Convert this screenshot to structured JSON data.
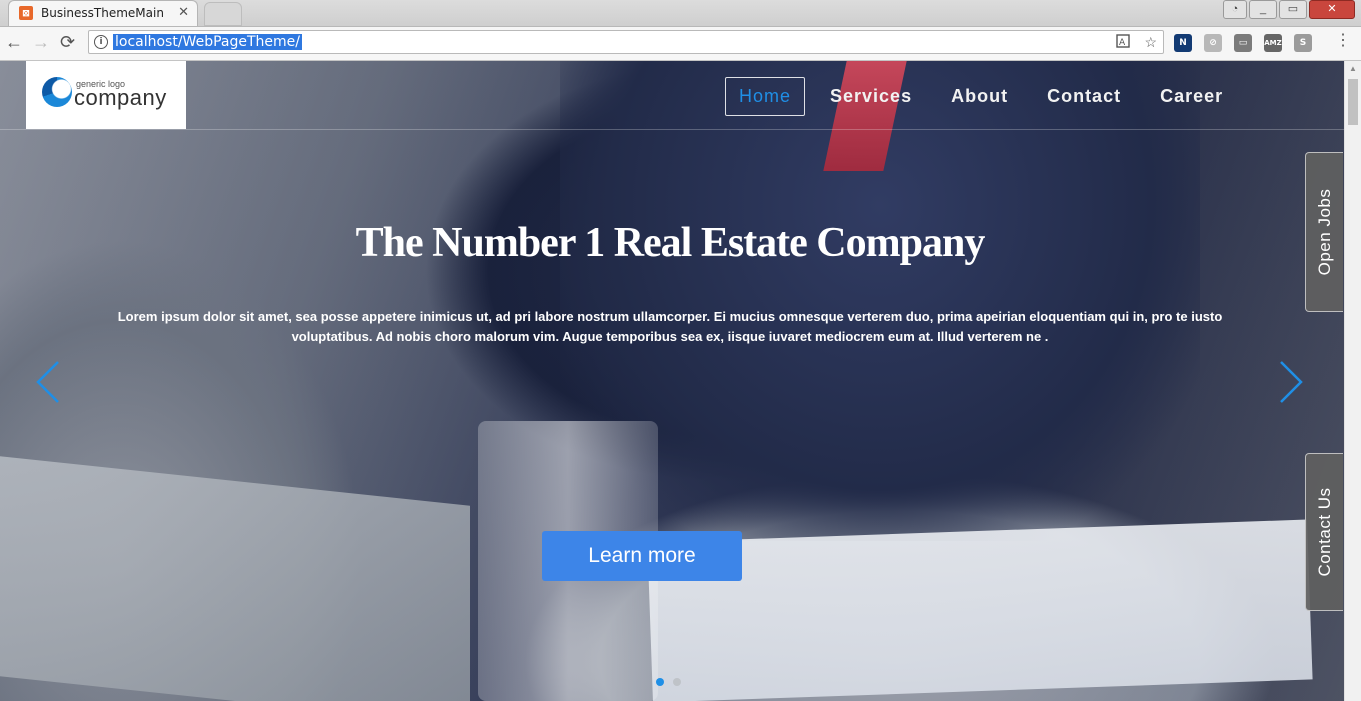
{
  "browser": {
    "tab_title": "BusinessThemeMain",
    "tab_close": "✕",
    "url": "localhost/WebPageTheme/",
    "back": "←",
    "forward": "→",
    "reload": "⟳",
    "info": "i",
    "translate": "⌘",
    "bookmark": "☆",
    "extensions": [
      {
        "label": "N",
        "color": "#123a73"
      },
      {
        "label": "⊘",
        "color": "#b8b8b8"
      },
      {
        "label": "▭",
        "color": "#7b7b7b"
      },
      {
        "label": "AMZ",
        "color": "#666666"
      },
      {
        "label": "S",
        "color": "#9b9b9b"
      }
    ],
    "menu": "⋮",
    "window": {
      "minimize": "▭",
      "maximize": "▭",
      "close": "✕",
      "profile": "👤"
    }
  },
  "logo": {
    "small_text": "generic logo",
    "big_text": "company"
  },
  "nav": {
    "items": [
      {
        "label": "Home",
        "active": true
      },
      {
        "label": "Services",
        "active": false
      },
      {
        "label": "About",
        "active": false
      },
      {
        "label": "Contact",
        "active": false
      },
      {
        "label": "Career",
        "active": false
      }
    ]
  },
  "hero": {
    "title": "The Number 1 Real Estate Company",
    "text": "Lorem ipsum dolor sit amet, sea posse appetere inimicus ut, ad pri labore nostrum ullamcorper. Ei mucius omnesque verterem duo, prima apeirian eloquentiam qui in, pro te iusto voluptatibus. Ad nobis choro malorum vim. Augue temporibus sea ex, iisque iuvaret mediocrem eum at. Illud verterem ne .",
    "button_label": "Learn more",
    "slide_count": 2,
    "active_slide": 1
  },
  "side_tabs": {
    "open_jobs": "Open Jobs",
    "contact_us": "Contact Us"
  },
  "colors": {
    "accent": "#3d85e8",
    "nav_active": "#1f8fe6"
  }
}
